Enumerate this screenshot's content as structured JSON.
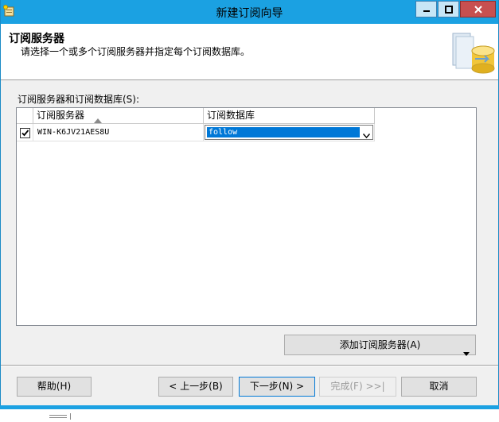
{
  "window": {
    "title": "新建订阅向导"
  },
  "header": {
    "title": "订阅服务器",
    "subtitle": "请选择一个或多个订阅服务器并指定每个订阅数据库。"
  },
  "grid": {
    "label": "订阅服务器和订阅数据库(S):",
    "columns": {
      "server": "订阅服务器",
      "database": "订阅数据库"
    },
    "rows": [
      {
        "checked": true,
        "server": "WIN-K6JV21AES8U",
        "database": "follow"
      }
    ]
  },
  "buttons": {
    "add_subscriber": "添加订阅服务器(A)",
    "help": "帮助(H)",
    "back": "< 上一步(B)",
    "next": "下一步(N) >",
    "finish": "完成(F) >>|",
    "cancel": "取消"
  },
  "colors": {
    "titlebar": "#1ba1e2",
    "selection": "#0078d7",
    "close": "#c75050"
  },
  "icons": {
    "app": "wizard-app-icon",
    "graphic": "database-wizard-graphic"
  }
}
